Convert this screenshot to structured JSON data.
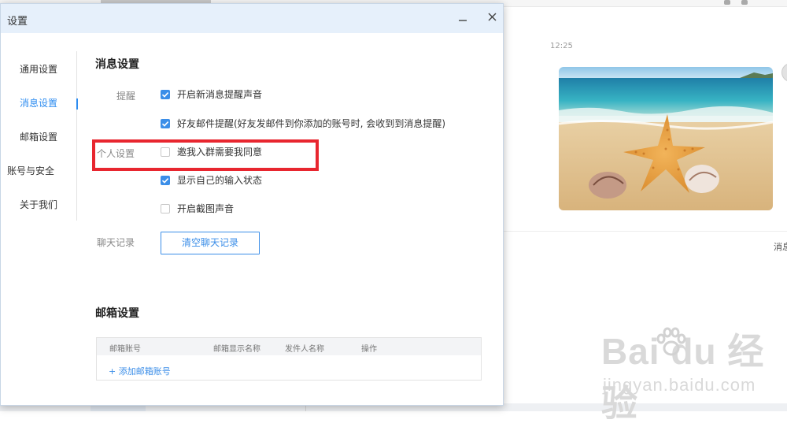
{
  "app": {
    "window_title": "设置",
    "minimize_glyph": "–",
    "close_glyph": "×"
  },
  "sidebar": {
    "items": [
      {
        "label": "通用设置",
        "active": false
      },
      {
        "label": "消息设置",
        "active": true
      },
      {
        "label": "邮箱设置",
        "active": false
      },
      {
        "label": "账号与安全",
        "active": false
      },
      {
        "label": "关于我们",
        "active": false
      }
    ]
  },
  "message_settings": {
    "title": "消息设置",
    "reminder_label": "提醒",
    "personal_label": "个人设置",
    "chat_history_label": "聊天记录",
    "options": [
      {
        "label": "开启新消息提醒声音",
        "checked": true
      },
      {
        "label": "好友邮件提醒(好友发邮件到你添加的账号时, 会收到到消息提醒)",
        "checked": true
      },
      {
        "label": "邀我入群需要我同意",
        "checked": false
      },
      {
        "label": "显示自己的输入状态",
        "checked": true
      },
      {
        "label": "开启截图声音",
        "checked": false
      }
    ],
    "clear_history_button": "清空聊天记录"
  },
  "mail_settings": {
    "title": "邮箱设置",
    "columns": [
      "邮箱账号",
      "邮箱显示名称",
      "发件人名称",
      "操作"
    ],
    "add_account_link": "+ 添加邮箱账号"
  },
  "background_chat": {
    "timestamp": "12:25",
    "partial_message": "消息"
  },
  "watermark": {
    "logo_text": "Bai du 经验",
    "url": "jingyan.baidu.com"
  },
  "colors": {
    "accent": "#3b8ee8",
    "highlight_border": "#e8262f",
    "titlebar_bg": "#e6f0fb"
  }
}
